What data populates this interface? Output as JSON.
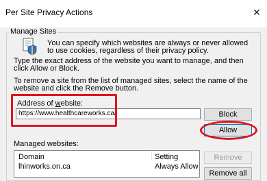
{
  "window": {
    "title": "Per Site Privacy Actions",
    "close_glyph": "✕"
  },
  "manage_sites": {
    "legend": "Manage Sites",
    "icon": "shield-document-icon",
    "description": "You can specify which websites are always or never allowed to use cookies, regardless of their privacy policy.",
    "instruction_1": "Type the exact address of the website you want to manage, and then click Allow or Block.",
    "instruction_2": "To remove a site from the list of managed sites, select the name of the website and click the Remove button."
  },
  "address": {
    "label_pre": "Address of ",
    "label_underlined": "w",
    "label_post": "ebsite:",
    "value": "https://www.healthcareworks.ca/"
  },
  "buttons": {
    "block": "Block",
    "allow": "Allow",
    "remove": "Remove",
    "remove_all": "Remove all"
  },
  "managed": {
    "label": "Managed websites:",
    "columns": [
      "Domain",
      "Setting"
    ],
    "rows": [
      {
        "domain": "lhinworks.on.ca",
        "setting": "Always Allow"
      }
    ]
  },
  "annotation_color": "#e0151d"
}
